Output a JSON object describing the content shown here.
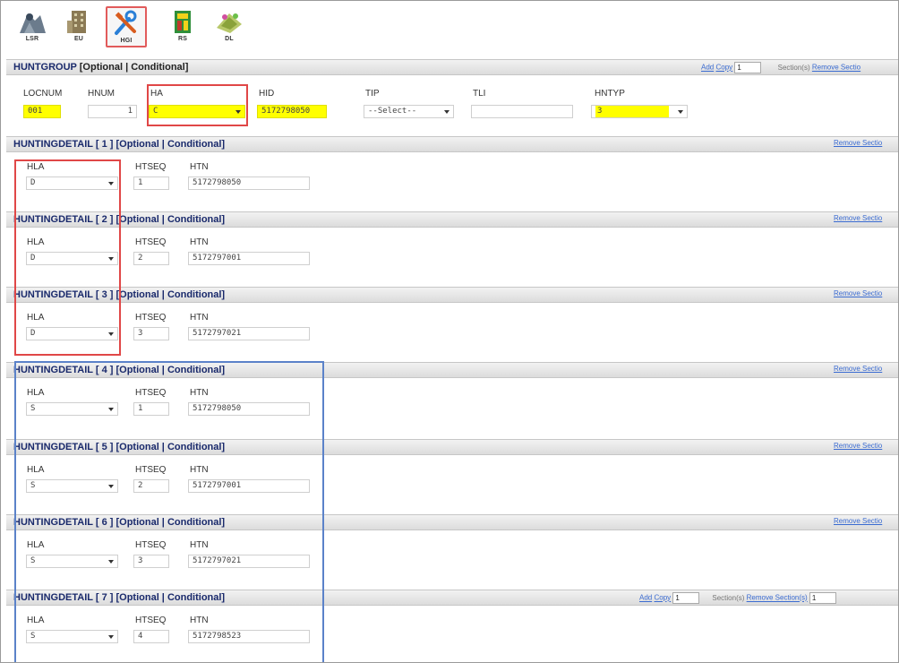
{
  "toolbar": {
    "buttons": [
      {
        "label": "LSR",
        "icon": "lsr-icon"
      },
      {
        "label": "EU",
        "icon": "eu-icon"
      },
      {
        "label": "HGI",
        "icon": "hgi-icon",
        "active": true
      },
      {
        "label": "RS",
        "icon": "rs-icon"
      },
      {
        "label": "DL",
        "icon": "dl-icon"
      }
    ]
  },
  "huntgroup": {
    "title_name": "HUNTGROUP",
    "title_rest": "[Optional | Conditional]",
    "add": "Add",
    "copy": "Copy",
    "count": "1",
    "sections_label": "Section(s)",
    "remove": "Remove Sectio",
    "fields": {
      "locnum_label": "LOCNUM",
      "locnum_value": "001",
      "hnum_label": "HNUM",
      "hnum_value": "1",
      "ha_label": "HA",
      "ha_value": "C",
      "hid_label": "HID",
      "hid_value": "5172798050",
      "tip_label": "TIP",
      "tip_value": "--Select--",
      "tli_label": "TLI",
      "tli_value": "",
      "hntyp_label": "HNTYP",
      "hntyp_value": "3"
    }
  },
  "detail_labels": {
    "hla": "HLA",
    "htseq": "HTSEQ",
    "htn": "HTN",
    "remove": "Remove Sectio"
  },
  "details": [
    {
      "title": "HUNTINGDETAIL [ 1 ] [Optional | Conditional]",
      "hla": "D",
      "htseq": "1",
      "htn": "5172798050"
    },
    {
      "title": "HUNTINGDETAIL [ 2 ] [Optional | Conditional]",
      "hla": "D",
      "htseq": "2",
      "htn": "5172797001"
    },
    {
      "title": "HUNTINGDETAIL [ 3 ] [Optional | Conditional]",
      "hla": "D",
      "htseq": "3",
      "htn": "5172797021"
    },
    {
      "title": "HUNTINGDETAIL [ 4 ] [Optional | Conditional]",
      "hla": "S",
      "htseq": "1",
      "htn": "5172798050"
    },
    {
      "title": "HUNTINGDETAIL [ 5 ] [Optional | Conditional]",
      "hla": "S",
      "htseq": "2",
      "htn": "5172797001"
    },
    {
      "title": "HUNTINGDETAIL [ 6 ] [Optional | Conditional]",
      "hla": "S",
      "htseq": "3",
      "htn": "5172797021"
    },
    {
      "title": "HUNTINGDETAIL [ 7 ] [Optional | Conditional]",
      "hla": "S",
      "htseq": "4",
      "htn": "5172798523"
    }
  ],
  "detail7_controls": {
    "add": "Add",
    "copy": "Copy",
    "count": "1",
    "sections_label": "Section(s)",
    "remove": "Remove Section(s)",
    "count2": "1"
  },
  "colors": {
    "highlight_red": "#e04747",
    "highlight_blue": "#5b82c9",
    "field_yellow": "#ffff00",
    "title_blue": "#1a2a6c",
    "link_blue": "#3a6bd1"
  }
}
